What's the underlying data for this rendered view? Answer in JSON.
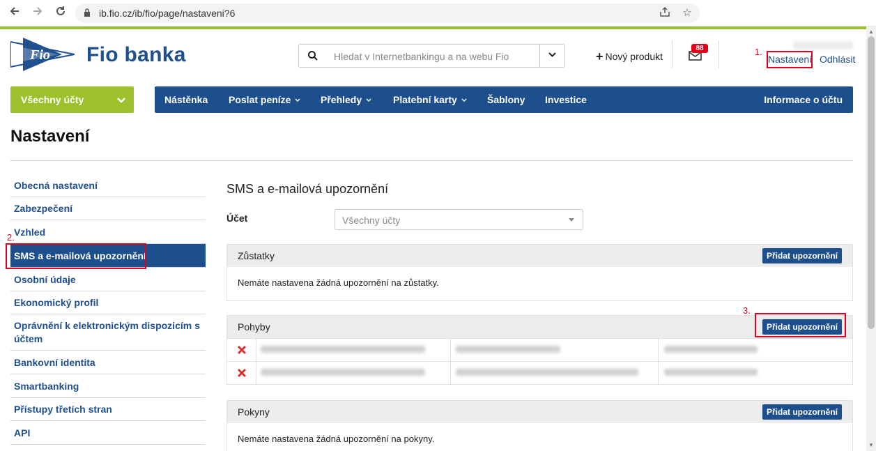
{
  "browser": {
    "url": "ib.fio.cz/ib/fio/page/nastaveni?6",
    "icons": [
      "back-arrow-icon",
      "forward-arrow-icon",
      "reload-icon",
      "lock-icon",
      "share-icon",
      "bookmark-star-icon"
    ]
  },
  "header": {
    "brand": "Fio banka",
    "logo_text": "Fio",
    "search_placeholder": "Hledat v Internetbankingu a na webu Fio",
    "new_product": "Nový produkt",
    "mail_count": "88",
    "settings_link": "Nastavení",
    "logout_link": "Odhlásit"
  },
  "annotations": {
    "step1": "1.",
    "step2": "2.",
    "step3": "3.",
    "color": "#e3001b"
  },
  "nav": {
    "accounts": "Všechny účty",
    "items": [
      "Nástěnka",
      "Poslat peníze",
      "Přehledy",
      "Platební karty",
      "Šablony",
      "Investice"
    ],
    "account_info": "Informace o účtu"
  },
  "page": {
    "title": "Nastavení"
  },
  "sidebar": {
    "items": [
      "Obecná nastavení",
      "Zabezpečení",
      "Vzhled",
      "SMS a e-mailová upozornění",
      "Osobní údaje",
      "Ekonomický profil",
      "Oprávnění k elektronickým dispozicím s účtem",
      "Bankovní identita",
      "Smartbanking",
      "Přístupy třetích stran",
      "API"
    ],
    "active_index": 3
  },
  "content": {
    "title": "SMS a e-mailová upozornění",
    "account_label": "Účet",
    "account_select": "Všechny účty",
    "add_button": "Přidat upozornění",
    "panels": {
      "balances": {
        "title": "Zůstatky",
        "empty": "Nemáte nastavena žádná upozornění na zůstatky."
      },
      "movements": {
        "title": "Pohyby",
        "rows": 2
      },
      "orders": {
        "title": "Pokyny",
        "empty": "Nemáte nastavena žádná upozornění na pokyny."
      }
    }
  },
  "colors": {
    "brand_blue": "#1d4f8d",
    "brand_green": "#9dc12c",
    "alert_red": "#e3001b"
  }
}
